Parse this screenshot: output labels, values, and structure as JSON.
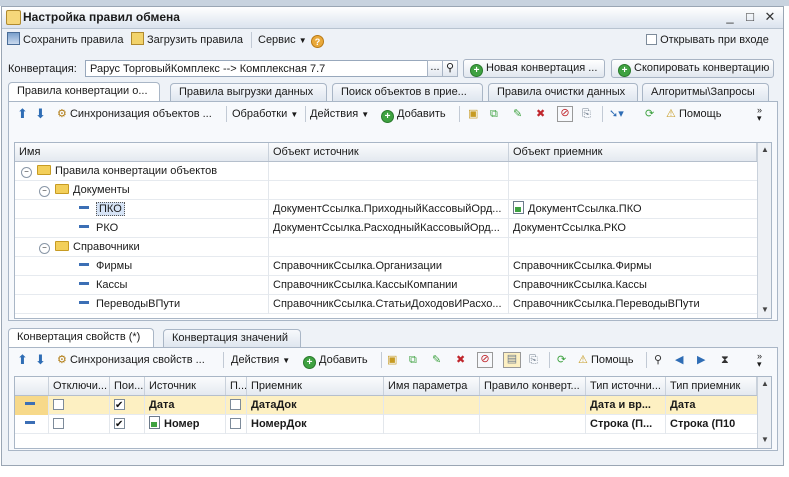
{
  "window": {
    "title": "Настройка правил обмена"
  },
  "toolbar": {
    "save_rules": "Сохранить правила",
    "load_rules": "Загрузить правила",
    "service": "Сервис",
    "open_on_startup": "Открывать при входе"
  },
  "conversion": {
    "label": "Конвертация:",
    "value": "Рарус ТорговыйКомплекс --> Комплексная 7.7",
    "new_button": "Новая конвертация ...",
    "copy_button": "Скопировать конвертацию"
  },
  "tabs": [
    "Правила конвертации о...",
    "Правила выгрузки данных",
    "Поиск объектов в прие...",
    "Правила очистки данных",
    "Алгоритмы\\Запросы"
  ],
  "upper_toolbar": {
    "sync": "Синхронизация объектов ...",
    "processing": "Обработки",
    "actions": "Действия",
    "add": "Добавить",
    "help": "Помощь"
  },
  "upper_grid": {
    "columns": [
      "Имя",
      "Объект источник",
      "Объект приемник"
    ],
    "rows": [
      {
        "name": "Правила конвертации объектов",
        "source": "",
        "target": "",
        "level": 0,
        "kind": "group"
      },
      {
        "name": "Документы",
        "source": "",
        "target": "",
        "level": 1,
        "kind": "group"
      },
      {
        "name": "ПКО",
        "source": "ДокументСсылка.ПриходныйКассовыйОрд...",
        "target": "ДокументСсылка.ПКО",
        "level": 2,
        "kind": "item",
        "selected": true,
        "target_icon": true
      },
      {
        "name": "РКО",
        "source": "ДокументСсылка.РасходныйКассовыйОрд...",
        "target": "ДокументСсылка.РКО",
        "level": 2,
        "kind": "item"
      },
      {
        "name": "Справочники",
        "source": "",
        "target": "",
        "level": 1,
        "kind": "group"
      },
      {
        "name": "Фирмы",
        "source": "СправочникСсылка.Организации",
        "target": "СправочникСсылка.Фирмы",
        "level": 2,
        "kind": "item"
      },
      {
        "name": "Кассы",
        "source": "СправочникСсылка.КассыКомпании",
        "target": "СправочникСсылка.Кассы",
        "level": 2,
        "kind": "item"
      },
      {
        "name": "ПереводыВПути",
        "source": "СправочникСсылка.СтатьиДоходовИРасхо...",
        "target": "СправочникСсылка.ПереводыВПути",
        "level": 2,
        "kind": "item"
      }
    ]
  },
  "lower_tabs": [
    "Конвертация свойств (*)",
    "Конвертация значений"
  ],
  "lower_toolbar": {
    "sync": "Синхронизация свойств ...",
    "actions": "Действия",
    "add": "Добавить",
    "help": "Помощь"
  },
  "lower_grid": {
    "columns": [
      "Отключи...",
      "Пои...",
      "Источник",
      "П...",
      "Приемник",
      "Имя параметра",
      "Правило конверт...",
      "Тип источни...",
      "Тип приемник"
    ],
    "rows": [
      {
        "disabled": false,
        "search": true,
        "source": "Дата",
        "p": false,
        "target": "ДатаДок",
        "param": "",
        "rule": "",
        "source_type": "Дата и вр...",
        "target_type": "Дата",
        "highlighted": true
      },
      {
        "disabled": false,
        "search": true,
        "source": "Номер",
        "p": false,
        "target": "НомерДок",
        "param": "",
        "rule": "",
        "source_type": "Строка (П...",
        "target_type": "Строка (П10",
        "highlighted": false
      }
    ]
  }
}
